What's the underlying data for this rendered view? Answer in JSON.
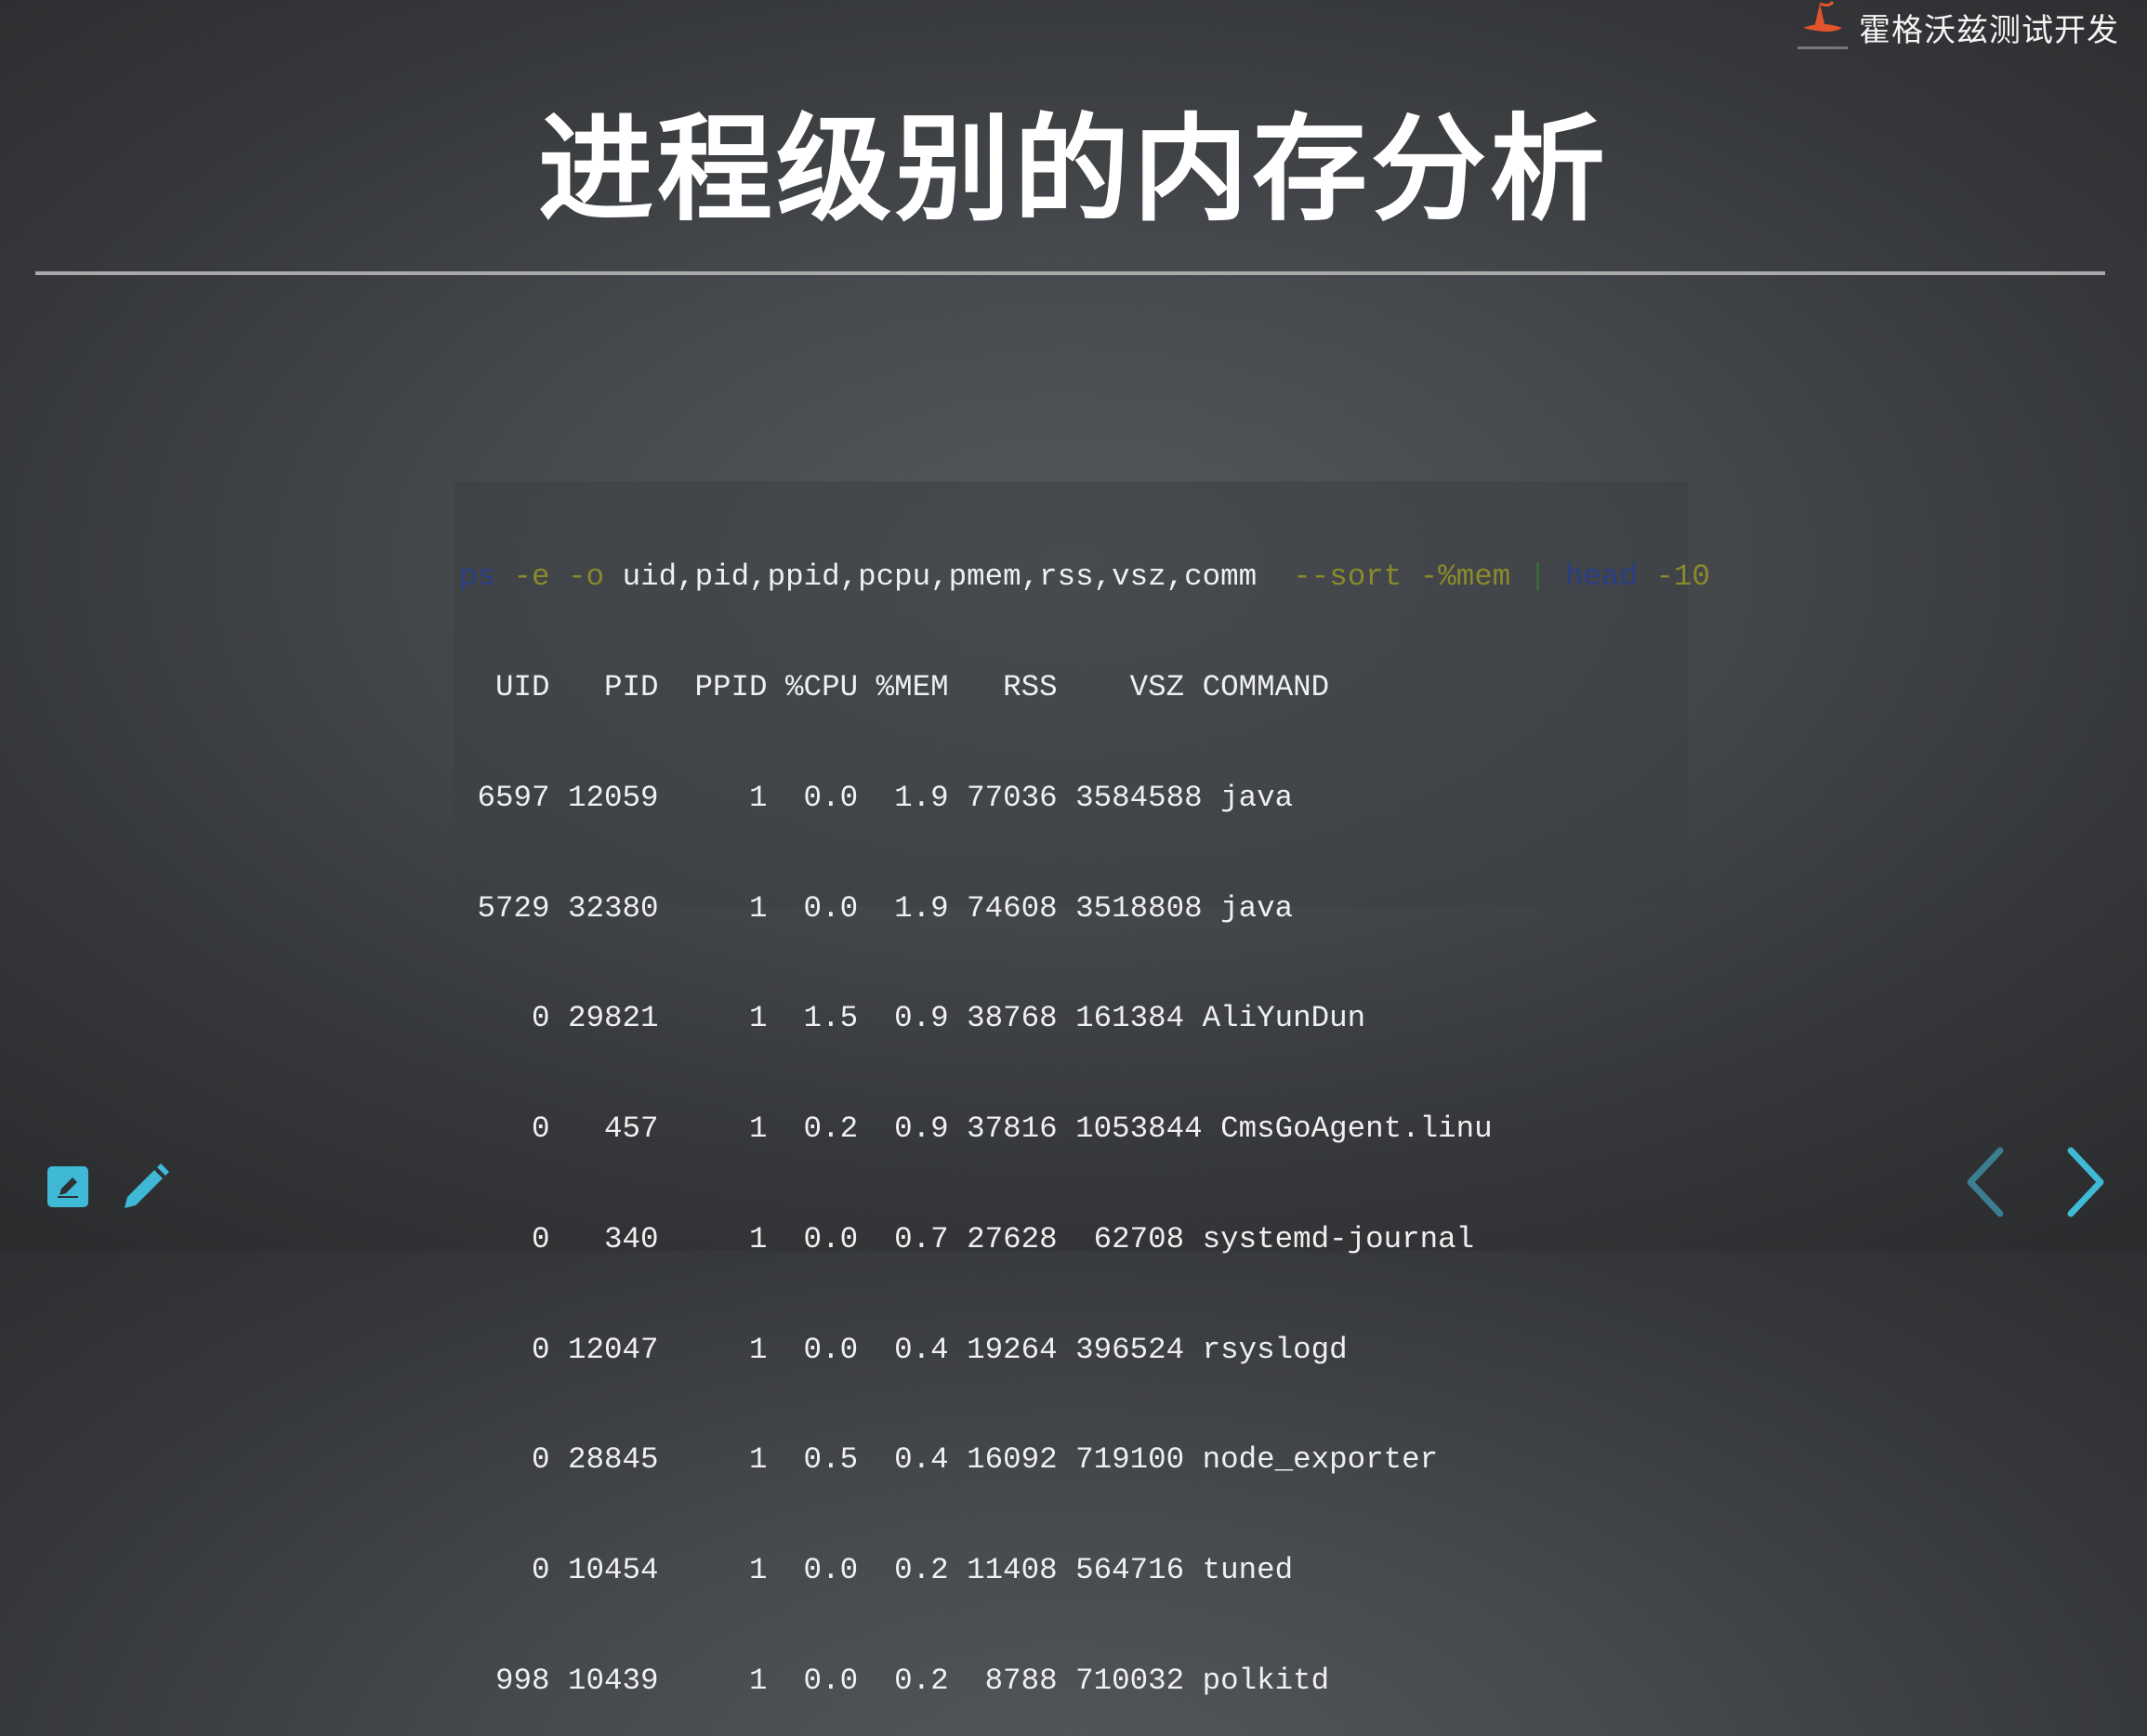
{
  "brand": {
    "name": "霍格沃兹测试开发"
  },
  "slide": {
    "title": "进程级别的内存分析"
  },
  "command": {
    "ps": "ps",
    "flags1": "-e -o",
    "fields": "uid,pid,ppid,pcpu,pmem,rss,vsz,comm",
    "sort": "--sort -%mem",
    "pipe": "|",
    "head": "head",
    "head_arg": "-10"
  },
  "table": {
    "header": "  UID   PID  PPID %CPU %MEM   RSS    VSZ COMMAND",
    "rows": [
      " 6597 12059     1  0.0  1.9 77036 3584588 java",
      " 5729 32380     1  0.0  1.9 74608 3518808 java",
      "    0 29821     1  1.5  0.9 38768 161384 AliYunDun",
      "    0   457     1  0.2  0.9 37816 1053844 CmsGoAgent.linu",
      "    0   340     1  0.0  0.7 27628  62708 systemd-journal",
      "    0 12047     1  0.0  0.4 19264 396524 rsyslogd",
      "    0 28845     1  0.5  0.4 16092 719100 node_exporter",
      "    0 10454     1  0.0  0.2 11408 564716 tuned",
      "  998 10439     1  0.0  0.2  8788 710032 polkitd"
    ]
  },
  "colors": {
    "accent": "#3fb9d6",
    "keyword": "#2a3e86",
    "flag": "#8a8a2c",
    "logo": "#e2542b"
  },
  "icons": [
    "hat-logo-icon",
    "edit-icon",
    "pencil-icon",
    "chevron-left-icon",
    "chevron-right-icon"
  ]
}
